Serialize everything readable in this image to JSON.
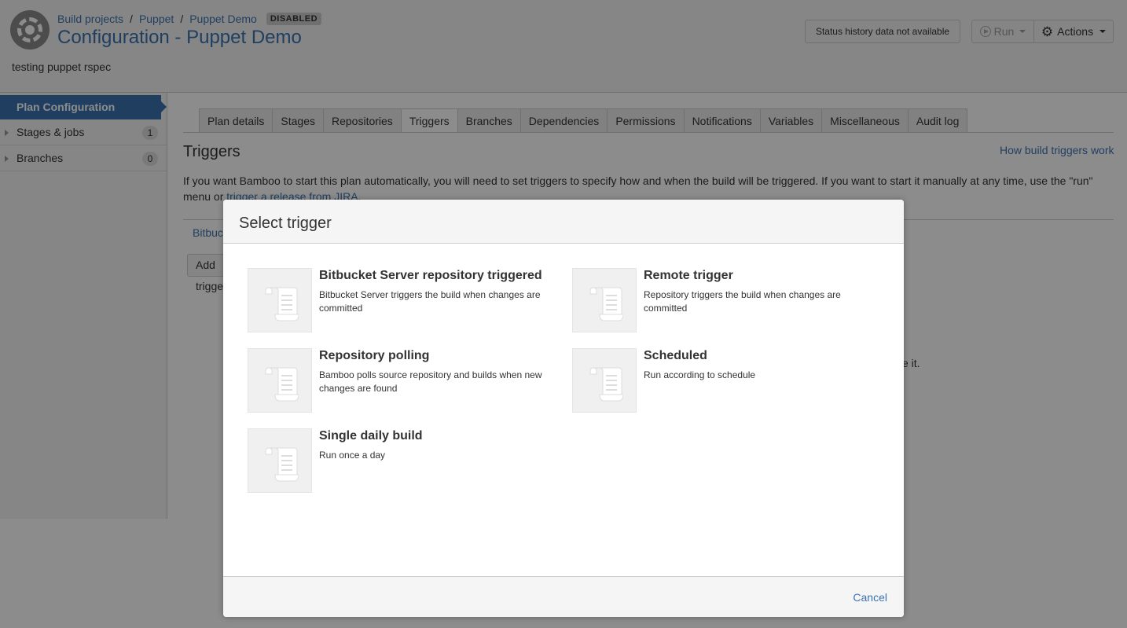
{
  "header": {
    "breadcrumbs": [
      "Build projects",
      "Puppet",
      "Puppet Demo"
    ],
    "separator": "/",
    "status_badge": "DISABLED",
    "title": "Configuration - Puppet Demo",
    "description": "testing puppet rspec",
    "status_history": "Status history data not available",
    "run_label": "Run",
    "actions_label": "Actions"
  },
  "sidebar": {
    "active": "Plan Configuration",
    "items": [
      {
        "label": "Stages & jobs",
        "count": "1"
      },
      {
        "label": "Branches",
        "count": "0"
      }
    ]
  },
  "main": {
    "tabs": [
      "Plan details",
      "Stages",
      "Repositories",
      "Triggers",
      "Branches",
      "Dependencies",
      "Permissions",
      "Notifications",
      "Variables",
      "Miscellaneous",
      "Audit log"
    ],
    "active_tab": "Triggers",
    "section_title": "Triggers",
    "help_link": "How build triggers work",
    "intro_text": "If you want Bamboo to start this plan automatically, you will need to set triggers to specify how and when the build will be triggered. If you want to start it manually at any time, use the \"run\" menu or ",
    "intro_link": "trigger a release from JIRA",
    "intro_end": ".",
    "row_link": "Bitbucket",
    "add_trigger": "Add trigger",
    "partial_text": "e it."
  },
  "dialog": {
    "title": "Select trigger",
    "options": [
      {
        "name": "Bitbucket Server repository triggered",
        "desc": "Bitbucket Server triggers the build when changes are committed",
        "icon": "scroll-icon"
      },
      {
        "name": "Remote trigger",
        "desc": "Repository triggers the build when changes are committed",
        "icon": "scroll-icon"
      },
      {
        "name": "Repository polling",
        "desc": "Bamboo polls source repository and builds when new changes are found",
        "icon": "scroll-icon"
      },
      {
        "name": "Scheduled",
        "desc": "Run according to schedule",
        "icon": "scroll-icon"
      },
      {
        "name": "Single daily build",
        "desc": "Run once a day",
        "icon": "scroll-icon"
      }
    ],
    "cancel": "Cancel"
  },
  "colors": {
    "link": "#3b73af",
    "sidebar_active": "#3b73af",
    "overlay": "rgba(0,0,0,0.45)"
  }
}
